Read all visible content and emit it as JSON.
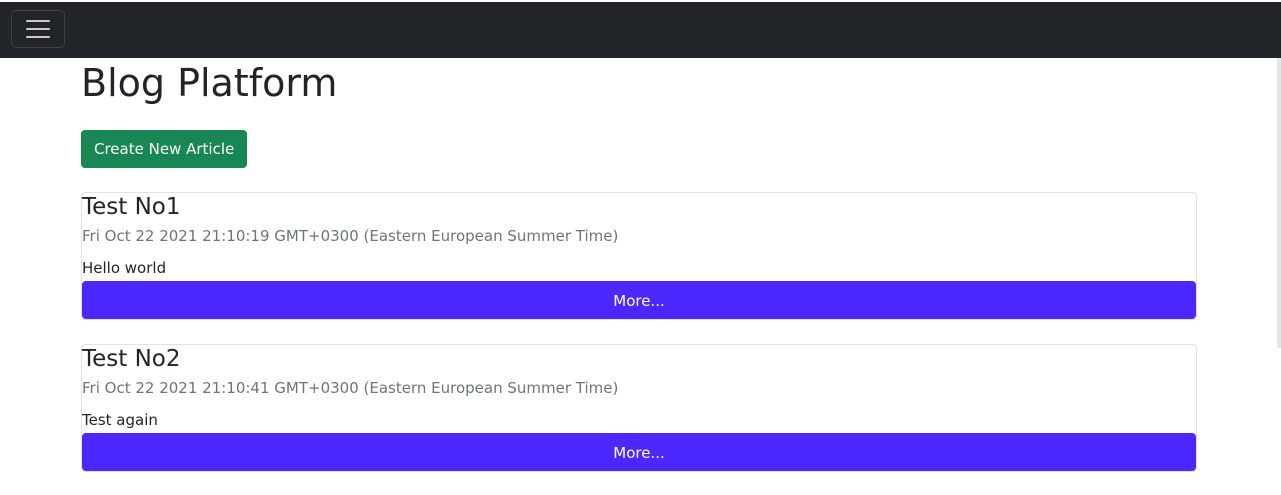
{
  "navbar": {
    "toggle_icon": "hamburger-menu-icon"
  },
  "page": {
    "title": "Blog Platform",
    "create_label": "Create New Article"
  },
  "articles": [
    {
      "title": "Test No1",
      "date": "Fri Oct 22 2021 21:10:19 GMT+0300 (Eastern European Summer Time)",
      "body": "Hello world",
      "more_label": "More..."
    },
    {
      "title": "Test No2",
      "date": "Fri Oct 22 2021 21:10:41 GMT+0300 (Eastern European Summer Time)",
      "body": "Test again",
      "more_label": "More..."
    }
  ],
  "colors": {
    "navbar_bg": "#212529",
    "create_button": "#198754",
    "more_button": "#4c28ff"
  }
}
